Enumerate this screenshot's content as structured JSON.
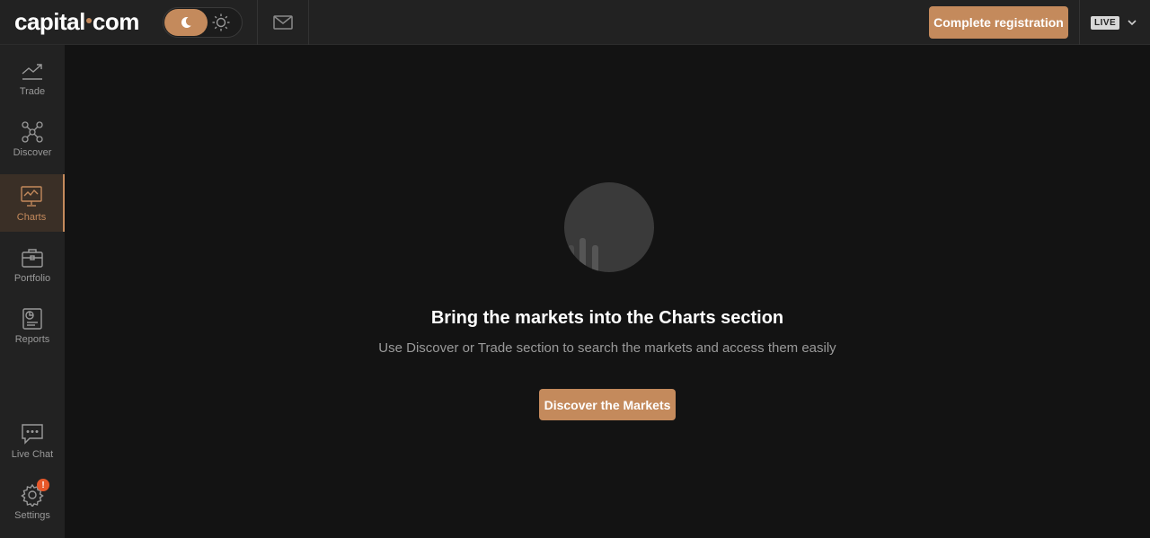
{
  "header": {
    "logo_left": "capital",
    "logo_right": "com",
    "complete_registration": "Complete registration",
    "account_mode": "LIVE",
    "theme_icons": [
      "moon-icon",
      "sun-icon"
    ],
    "mail_icon": "mail-icon"
  },
  "sidebar": {
    "items": [
      {
        "label": "Trade",
        "icon": "trend-icon"
      },
      {
        "label": "Discover",
        "icon": "network-icon"
      },
      {
        "label": "Charts",
        "icon": "chart-monitor-icon",
        "active": true
      },
      {
        "label": "Portfolio",
        "icon": "briefcase-icon"
      },
      {
        "label": "Reports",
        "icon": "report-icon"
      },
      {
        "label": "Live Chat",
        "icon": "chat-icon"
      },
      {
        "label": "Settings",
        "icon": "gear-icon",
        "badge": "!"
      }
    ]
  },
  "main": {
    "title": "Bring the markets into the Charts section",
    "subtitle": "Use Discover or Trade section to search the markets and access them easily",
    "discover_button": "Discover the Markets"
  },
  "colors": {
    "accent": "#c48a5c",
    "background": "#131313",
    "panel": "#222222",
    "badge": "#e8582a"
  }
}
